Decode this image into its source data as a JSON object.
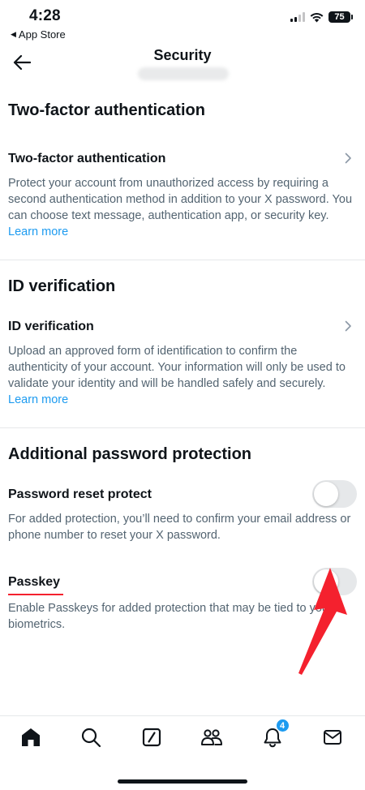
{
  "status_bar": {
    "time": "4:28",
    "back_app": "App Store",
    "battery": "75"
  },
  "header": {
    "title": "Security"
  },
  "sections": [
    {
      "heading": "Two-factor authentication",
      "row_label": "Two-factor authentication",
      "description": "Protect your account from unauthorized access by requiring a second authentication method in addition to your X password. You can choose text message, authentication app, or security key.",
      "link": "Learn more"
    },
    {
      "heading": "ID verification",
      "row_label": "ID verification",
      "description": "Upload an approved form of identification to confirm the authenticity of your account. Your information will only be used to validate your identity and will be handled safely and securely.",
      "link": "Learn more"
    },
    {
      "heading": "Additional password protection",
      "password_reset": {
        "label": "Password reset protect",
        "description": "For added protection, you’ll need to confirm your email address or phone number to reset your X password.",
        "enabled": false
      },
      "passkey": {
        "label": "Passkey",
        "description": "Enable Passkeys for added protection that may be tied to your biometrics.",
        "enabled": false
      }
    }
  ],
  "tab_bar": {
    "items": [
      {
        "name": "home",
        "icon": "home-icon"
      },
      {
        "name": "search",
        "icon": "search-icon"
      },
      {
        "name": "grok",
        "icon": "grok-icon"
      },
      {
        "name": "communities",
        "icon": "communities-icon"
      },
      {
        "name": "notifications",
        "icon": "bell-icon",
        "badge": "4"
      },
      {
        "name": "messages",
        "icon": "mail-icon"
      }
    ]
  },
  "colors": {
    "accent": "#1d9bf0",
    "annotation": "#f4212e",
    "text_primary": "#0f1419",
    "text_secondary": "#536471"
  }
}
